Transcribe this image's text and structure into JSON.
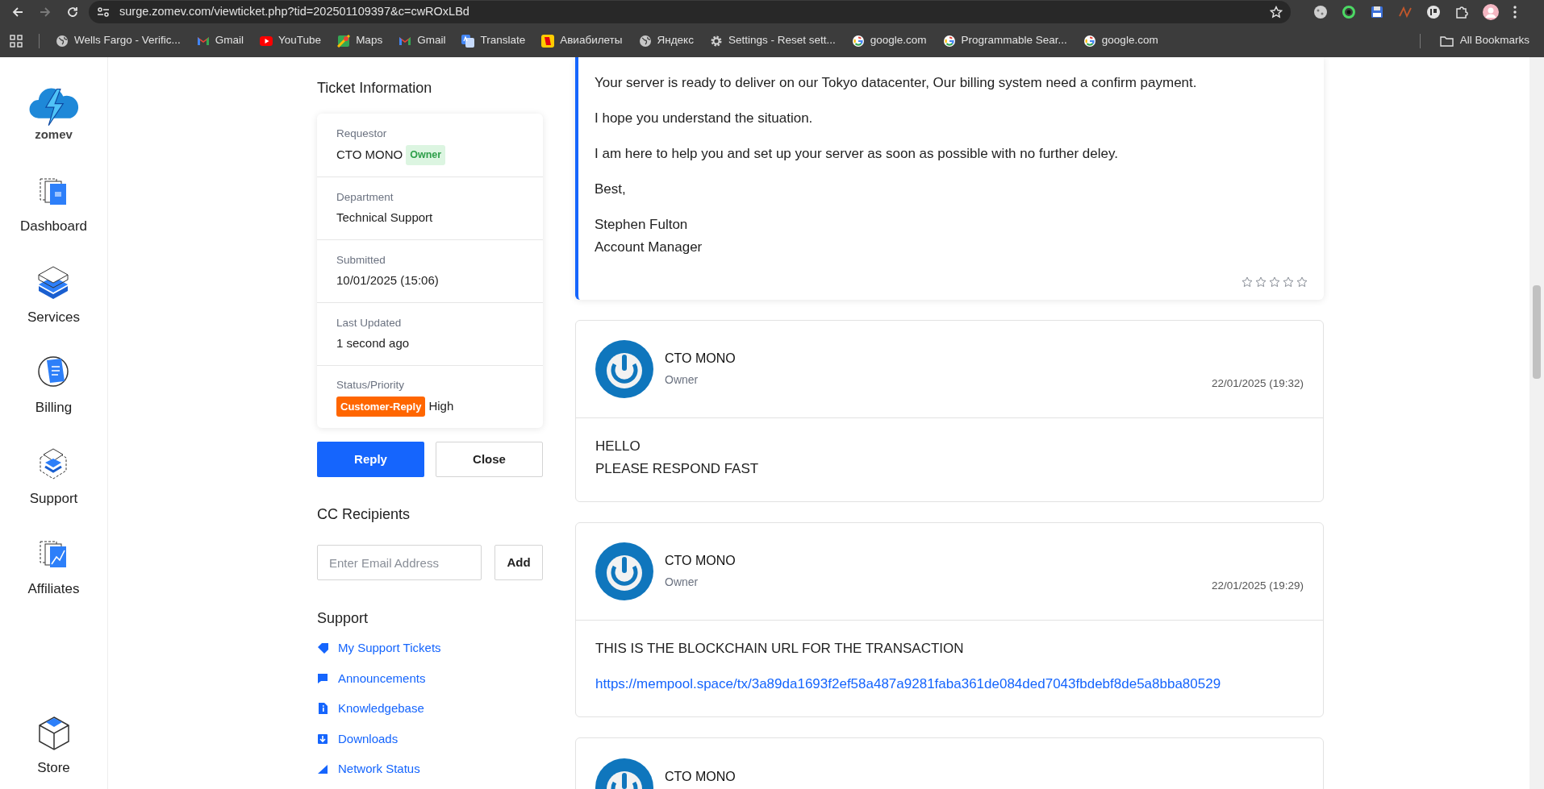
{
  "browser": {
    "url": "surge.zomev.com/viewticket.php?tid=202501109397&c=cwROxLBd",
    "bookmarks": [
      {
        "label": "Wells Fargo - Verific...",
        "kind": "globe"
      },
      {
        "label": "Gmail",
        "kind": "mail"
      },
      {
        "label": "YouTube",
        "kind": "play"
      },
      {
        "label": "Maps",
        "kind": "map"
      },
      {
        "label": "Gmail",
        "kind": "mail"
      },
      {
        "label": "Translate",
        "kind": "translate"
      },
      {
        "label": "Авиабилеты",
        "kind": "ticket"
      },
      {
        "label": "Яндекс",
        "kind": "globe"
      },
      {
        "label": "Settings - Reset sett...",
        "kind": "gear"
      },
      {
        "label": "google.com",
        "kind": "ring"
      },
      {
        "label": "Programmable Sear...",
        "kind": "ring"
      },
      {
        "label": "google.com",
        "kind": "ring"
      }
    ],
    "all_bookmarks": "All Bookmarks"
  },
  "sidebar": {
    "logo_text": "zomev",
    "items": [
      {
        "label": "Dashboard",
        "kind": "dashboard"
      },
      {
        "label": "Services",
        "kind": "services"
      },
      {
        "label": "Billing",
        "kind": "billing"
      },
      {
        "label": "Support",
        "kind": "support"
      },
      {
        "label": "Affiliates",
        "kind": "affiliates"
      }
    ],
    "bottom_item": {
      "label": "Store",
      "kind": "store"
    }
  },
  "ticket_information": {
    "title": "Ticket Information",
    "fields": [
      {
        "kind": "requestor",
        "label": "Requestor",
        "value": "CTO MONO",
        "tag": "Owner"
      },
      {
        "kind": "text",
        "label": "Department",
        "value": "Technical Support"
      },
      {
        "kind": "text",
        "label": "Submitted",
        "value": "10/01/2025 (15:06)"
      },
      {
        "kind": "text",
        "label": "Last Updated",
        "value": "1 second ago"
      },
      {
        "kind": "status",
        "label": "Status/Priority",
        "status": "Customer-Reply",
        "value": "High"
      }
    ],
    "buttons": [
      "Reply",
      "Close"
    ]
  },
  "cc_recipients": {
    "title": "CC Recipients",
    "placeholder": "Enter Email Address",
    "button": "Add"
  },
  "support": {
    "title": "Support",
    "links": [
      {
        "label": "My Support Tickets",
        "kind": "tag"
      },
      {
        "label": "Announcements",
        "kind": "chat"
      },
      {
        "label": "Knowledgebase",
        "kind": "file"
      },
      {
        "label": "Downloads",
        "kind": "download"
      },
      {
        "label": "Network Status",
        "kind": "signal"
      }
    ]
  },
  "messages": [
    {
      "kind": "staff",
      "stars": 0,
      "paragraphs": [
        {
          "kind": "text",
          "lines": [
            "Your server is ready to deliver on our Tokyo datacenter, Our billing system need a confirm payment."
          ]
        },
        {
          "kind": "text",
          "lines": [
            "I hope you understand the situation."
          ]
        },
        {
          "kind": "text",
          "lines": [
            "I am here to help you and set up your server as soon as possible with no further deley."
          ]
        },
        {
          "kind": "text",
          "lines": [
            "Best,"
          ]
        },
        {
          "kind": "text",
          "lines": [
            "Stephen Fulton",
            "Account Manager"
          ]
        }
      ]
    },
    {
      "kind": "client",
      "author": "CTO MONO",
      "role": "Owner",
      "date": "22/01/2025 (19:32)",
      "paragraphs": [
        {
          "kind": "text",
          "lines": [
            "HELLO",
            "PLEASE RESPOND FAST"
          ]
        }
      ]
    },
    {
      "kind": "client",
      "author": "CTO MONO",
      "role": "Owner",
      "date": "22/01/2025 (19:29)",
      "paragraphs": [
        {
          "kind": "text",
          "lines": [
            "THIS IS THE BLOCKCHAIN URL FOR THE TRANSACTION"
          ]
        },
        {
          "kind": "link",
          "lines": [
            "https://mempool.space/tx/3a89da1693f2ef58a487a9281faba361de084ded7043fbdebf8de5a8bba80529"
          ]
        }
      ]
    },
    {
      "kind": "client",
      "author": "CTO MONO"
    }
  ]
}
